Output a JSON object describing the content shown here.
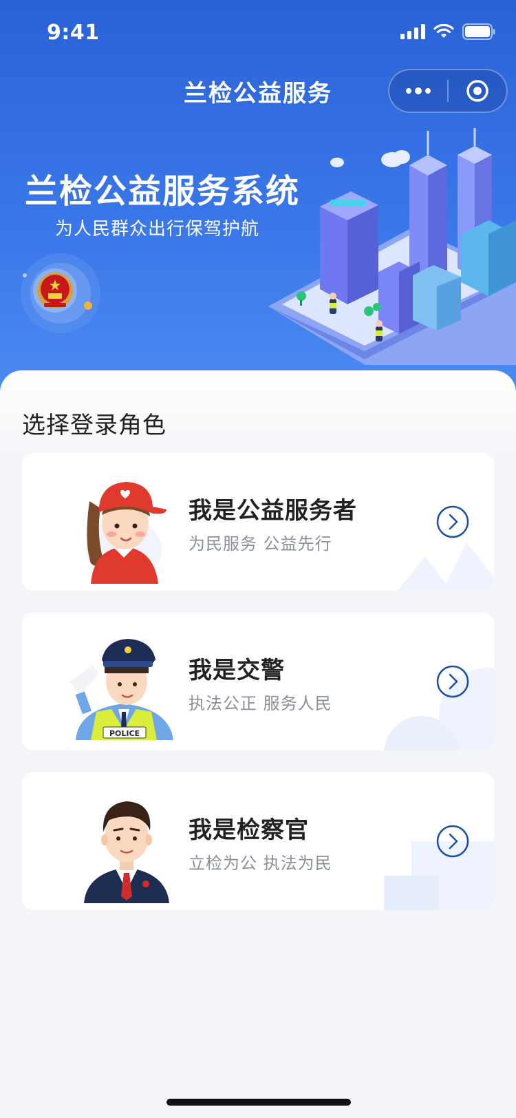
{
  "status_bar": {
    "time": "9:41"
  },
  "nav": {
    "title": "兰检公益服务"
  },
  "banner": {
    "title": "兰检公益服务系统",
    "subtitle": "为人民群众出行保驾护航"
  },
  "section": {
    "title": "选择登录角色"
  },
  "roles": [
    {
      "title": "我是公益服务者",
      "subtitle": "为民服务 公益先行",
      "icon": "volunteer-avatar"
    },
    {
      "title": "我是交警",
      "subtitle": "执法公正 服务人民",
      "icon": "police-avatar",
      "badge_text": "POLICE"
    },
    {
      "title": "我是检察官",
      "subtitle": "立检为公 执法为民",
      "icon": "prosecutor-avatar"
    }
  ],
  "colors": {
    "primary": "#2f6ee3",
    "arrow": "#1e4fa8",
    "text_main": "#222222",
    "text_sub": "#8a8f99"
  }
}
